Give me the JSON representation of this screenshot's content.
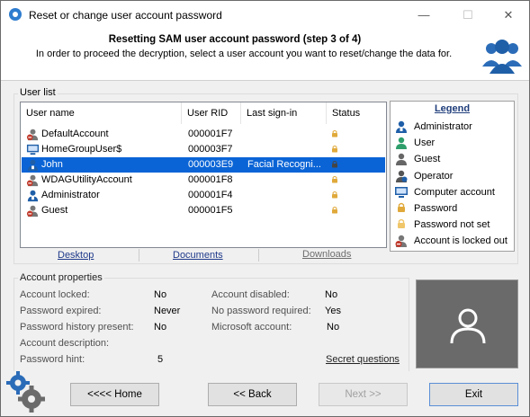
{
  "window": {
    "title": "Reset or change user account password",
    "minimize": "—",
    "maximize": "☐",
    "close": "✕"
  },
  "header": {
    "title": "Resetting SAM user account password (step 3 of 4)",
    "subtitle": "In order to proceed the decryption, select a user account you want to reset/change the data for."
  },
  "user_list": {
    "group_label": "User list",
    "columns": [
      "User name",
      "User RID",
      "Last sign-in",
      "Status"
    ],
    "rows": [
      {
        "name": "DefaultAccount",
        "rid": "000001F7",
        "last": "",
        "icon": "locked-user-icon",
        "selected": false
      },
      {
        "name": "HomeGroupUser$",
        "rid": "000003F7",
        "last": "",
        "icon": "computer-account-icon",
        "selected": false
      },
      {
        "name": "John",
        "rid": "000003E9",
        "last": "Facial Recogni...",
        "icon": "administrator-icon",
        "selected": true
      },
      {
        "name": "WDAGUtilityAccount",
        "rid": "000001F8",
        "last": "",
        "icon": "locked-user-icon",
        "selected": false
      },
      {
        "name": "Administrator",
        "rid": "000001F4",
        "last": "",
        "icon": "administrator-icon",
        "selected": false
      },
      {
        "name": "Guest",
        "rid": "000001F5",
        "last": "",
        "icon": "locked-user-icon",
        "selected": false
      }
    ]
  },
  "links": {
    "desktop": "Desktop",
    "documents": "Documents",
    "downloads": "Downloads"
  },
  "legend": {
    "title": "Legend",
    "items": [
      {
        "label": "Administrator",
        "icon": "administrator-icon"
      },
      {
        "label": "User",
        "icon": "user-icon"
      },
      {
        "label": "Guest",
        "icon": "guest-icon"
      },
      {
        "label": "Operator",
        "icon": "operator-icon"
      },
      {
        "label": "Computer account",
        "icon": "computer-account-icon"
      },
      {
        "label": "Password",
        "icon": "password-lock-icon"
      },
      {
        "label": "Password not set",
        "icon": "password-not-set-icon"
      },
      {
        "label": "Account is locked out",
        "icon": "locked-out-icon"
      }
    ]
  },
  "account_properties": {
    "group_label": "Account properties",
    "account_locked_label": "Account locked:",
    "account_locked_value": "No",
    "password_expired_label": "Password expired:",
    "password_expired_value": "Never",
    "password_history_label": "Password history present:",
    "password_history_value": "No",
    "account_description_label": "Account description:",
    "password_hint_label": "Password hint:",
    "password_hint_value": "5",
    "account_disabled_label": "Account disabled:",
    "account_disabled_value": "No",
    "no_password_required_label": "No password required:",
    "no_password_required_value": "Yes",
    "microsoft_account_label": "Microsoft account:",
    "microsoft_account_value": "No",
    "secret_questions_link": "Secret questions"
  },
  "buttons": {
    "home": "<<<< Home",
    "back": "<< Back",
    "next": "Next >>",
    "exit": "Exit"
  },
  "colors": {
    "selection": "#0a64d6",
    "accent_blue": "#1f5fa8",
    "lock_gold": "#e0a93a"
  }
}
